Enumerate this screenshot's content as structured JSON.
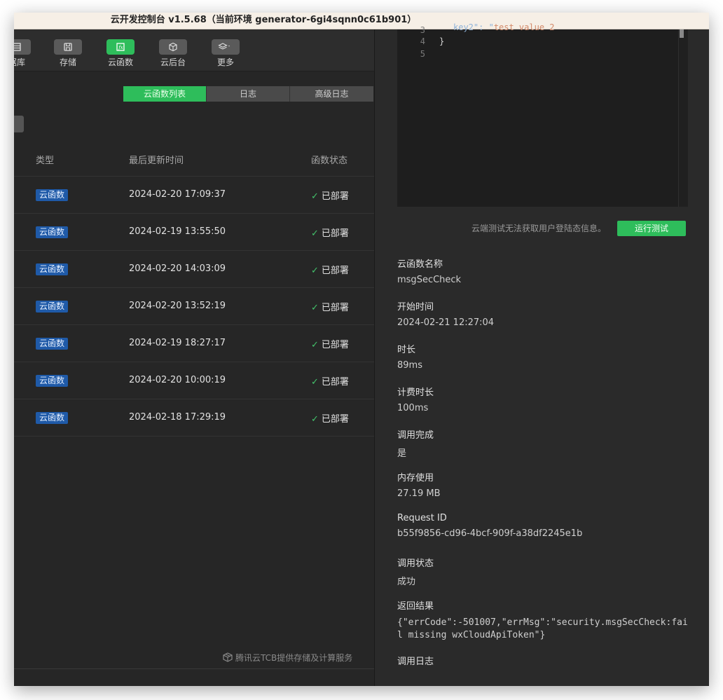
{
  "window_title": "云开发控制台 v1.5.68（当前环境 generator-6gi4sqnn0c61b901）",
  "toolbar": {
    "items": [
      {
        "label": "据库",
        "icon": "database-icon"
      },
      {
        "label": "存储",
        "icon": "storage-icon"
      },
      {
        "label": "云函数",
        "icon": "function-icon",
        "active": true
      },
      {
        "label": "云后台",
        "icon": "cube-icon"
      },
      {
        "label": "更多",
        "icon": "layers-icon"
      }
    ]
  },
  "tabs": [
    "云函数列表",
    "日志",
    "高级日志"
  ],
  "table": {
    "headers": {
      "type": "类型",
      "updated": "最后更新时间",
      "status": "函数状态"
    },
    "rows": [
      {
        "type": "云函数",
        "updated": "2024-02-20 17:09:37",
        "status": "已部署"
      },
      {
        "type": "云函数",
        "updated": "2024-02-19 13:55:50",
        "status": "已部署"
      },
      {
        "type": "云函数",
        "updated": "2024-02-20 14:03:09",
        "status": "已部署"
      },
      {
        "type": "云函数",
        "updated": "2024-02-20 13:52:19",
        "status": "已部署"
      },
      {
        "type": "云函数",
        "updated": "2024-02-19 18:27:17",
        "status": "已部署"
      },
      {
        "type": "云函数",
        "updated": "2024-02-20 10:00:19",
        "status": "已部署"
      },
      {
        "type": "云函数",
        "updated": "2024-02-18 17:29:19",
        "status": "已部署"
      }
    ]
  },
  "footer_note": "腾讯云TCB提供存储及计算服务",
  "editor": {
    "cut_line_key": "key2",
    "cut_line_value": "test value 2",
    "lines": [
      {
        "n": "3",
        "code": ""
      },
      {
        "n": "4",
        "code": "}"
      },
      {
        "n": "5",
        "code": ""
      }
    ]
  },
  "test": {
    "hint": "云端测试无法获取用户登陆态信息。",
    "run_button": "运行测试"
  },
  "details": [
    {
      "key": "云函数名称",
      "value": "msgSecCheck"
    },
    {
      "key": "开始时间",
      "value": "2024-02-21 12:27:04"
    },
    {
      "key": "时长",
      "value": "89ms"
    },
    {
      "key": "计费时长",
      "value": "100ms"
    },
    {
      "key": "调用完成",
      "value": "是"
    },
    {
      "key": "内存使用",
      "value": "27.19 MB"
    },
    {
      "key": "Request ID",
      "value": "b55f9856-cd96-4bcf-909f-a38df2245e1b"
    },
    {
      "key": "调用状态",
      "value": "成功"
    }
  ],
  "result": {
    "key": "返回结果",
    "value": "{\"errCode\":-501007,\"errMsg\":\"security.msgSecCheck:fail missing wxCloudApiToken\"}"
  },
  "log_label": "调用日志",
  "colors": {
    "accent": "#2ebd5b",
    "badge": "#1f5aa8",
    "bg": "#262626"
  }
}
